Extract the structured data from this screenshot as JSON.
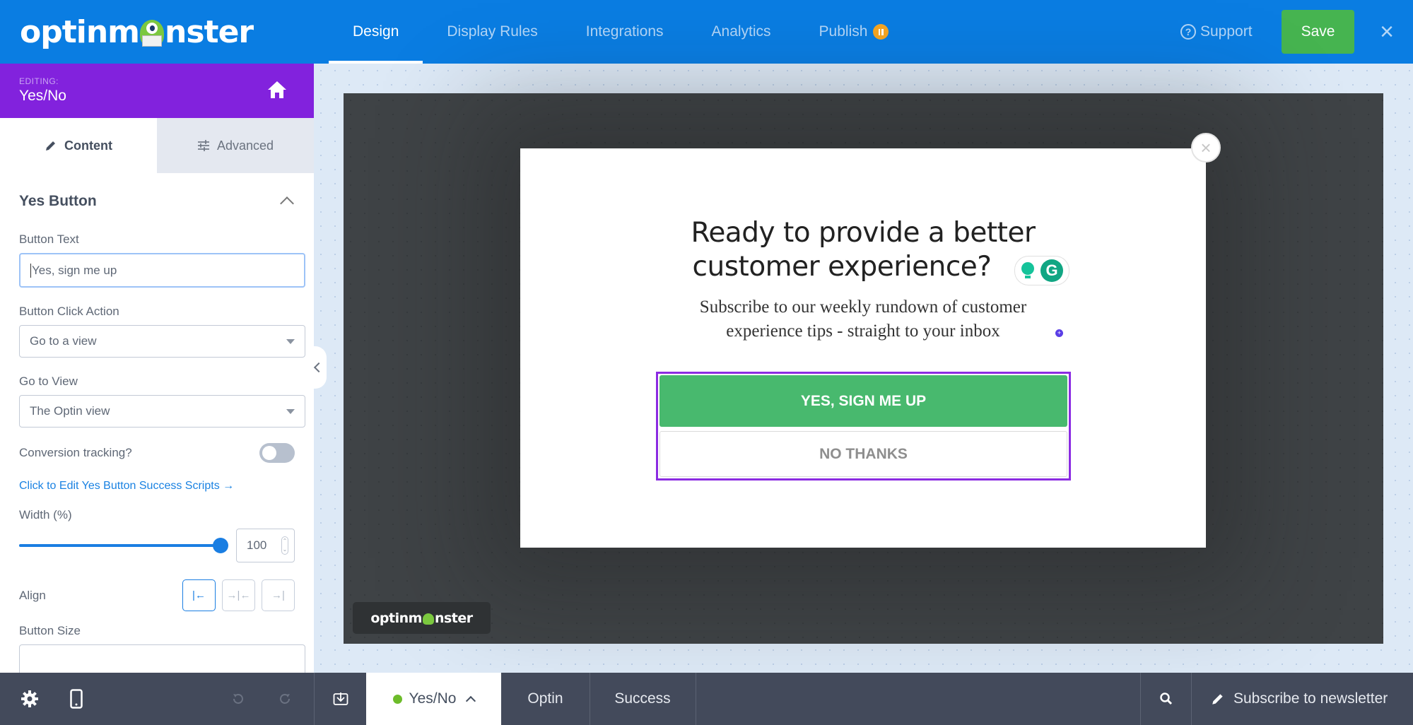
{
  "header": {
    "logo_text_left": "optinm",
    "logo_text_right": "nster",
    "nav": [
      {
        "label": "Design",
        "active": true
      },
      {
        "label": "Display Rules",
        "active": false
      },
      {
        "label": "Integrations",
        "active": false
      },
      {
        "label": "Analytics",
        "active": false
      },
      {
        "label": "Publish",
        "active": false,
        "badge": "pause-icon"
      }
    ],
    "support_label": "Support",
    "save_label": "Save",
    "close_icon": "×"
  },
  "sidebar": {
    "editing_label": "EDITING:",
    "editing_name": "Yes/No",
    "tabs": [
      {
        "label": "Content",
        "icon": "pencil-icon",
        "active": true
      },
      {
        "label": "Advanced",
        "icon": "sliders-icon",
        "active": false
      }
    ],
    "section_title": "Yes Button",
    "button_text_label": "Button Text",
    "button_text_value": "Yes, sign me up",
    "click_action_label": "Button Click Action",
    "click_action_value": "Go to a view",
    "goto_view_label": "Go to View",
    "goto_view_value": "The Optin view",
    "conversion_label": "Conversion tracking?",
    "conversion_enabled": false,
    "scripts_link": "Click to Edit Yes Button Success Scripts →",
    "width_label": "Width (%)",
    "width_value": "100",
    "width_fraction": 1.0,
    "align_label": "Align",
    "align_options": [
      {
        "icon": "align-left-icon",
        "glyph": "|←",
        "active": true
      },
      {
        "icon": "align-center-icon",
        "glyph": "→|←",
        "active": false
      },
      {
        "icon": "align-right-icon",
        "glyph": "→|",
        "active": false
      }
    ],
    "button_size_label": "Button Size"
  },
  "canvas": {
    "headline_line1": "Ready to provide a better",
    "headline_line2": "customer experience?",
    "subtext_line1": "Subscribe to our weekly rundown of customer",
    "subtext_line2": "experience tips - straight to your inbox",
    "yes_button": "YES, SIGN ME UP",
    "no_button": "NO THANKS",
    "popup_close": "×",
    "grammarly_g": "G",
    "powered_left": "optinm",
    "powered_right": "nster"
  },
  "bottombar": {
    "views": [
      {
        "label": "Yes/No",
        "active": true
      },
      {
        "label": "Optin",
        "active": false
      },
      {
        "label": "Success",
        "active": false
      }
    ],
    "campaign_name": "Subscribe to newsletter"
  }
}
